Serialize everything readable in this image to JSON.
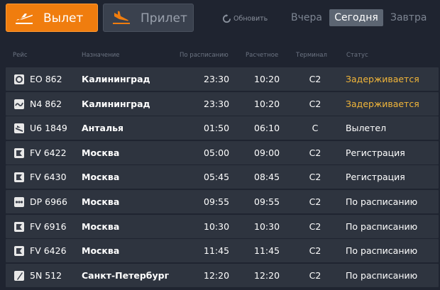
{
  "tabs": {
    "departures_label": "Вылет",
    "arrivals_label": "Прилет",
    "refresh_label": "Обновить"
  },
  "days": {
    "yesterday": "Вчера",
    "today": "Сегодня",
    "tomorrow": "Завтра"
  },
  "columns": {
    "flight": "Рейс",
    "destination": "Назначение",
    "scheduled": "По расписанию",
    "estimated": "Расчетное",
    "terminal": "Терминал",
    "status": "Статус"
  },
  "colors": {
    "accent": "#f07d0e",
    "delayed": "#f2b63a",
    "row_bg": "#2e343f",
    "page_bg": "#1f2430"
  },
  "flights": [
    {
      "logo": "circle-logo-icon",
      "flight": "EO 862",
      "destination": "Калининград",
      "scheduled": "23:30",
      "estimated": "10:20",
      "terminal": "C2",
      "status": "Задерживается",
      "delayed": true
    },
    {
      "logo": "wave-logo-icon",
      "flight": "N4 862",
      "destination": "Калининград",
      "scheduled": "23:30",
      "estimated": "10:20",
      "terminal": "C2",
      "status": "Задерживается",
      "delayed": true
    },
    {
      "logo": "wing-logo-icon",
      "flight": "U6 1849",
      "destination": "Анталья",
      "scheduled": "01:50",
      "estimated": "06:10",
      "terminal": "C",
      "status": "Вылетел",
      "delayed": false
    },
    {
      "logo": "flag-logo-icon",
      "flight": "FV 6422",
      "destination": "Москва",
      "scheduled": "05:00",
      "estimated": "09:00",
      "terminal": "C2",
      "status": "Регистрация",
      "delayed": false
    },
    {
      "logo": "flag-logo-icon",
      "flight": "FV 6430",
      "destination": "Москва",
      "scheduled": "05:45",
      "estimated": "08:45",
      "terminal": "C2",
      "status": "Регистрация",
      "delayed": false
    },
    {
      "logo": "dots-logo-icon",
      "flight": "DP 6966",
      "destination": "Москва",
      "scheduled": "09:55",
      "estimated": "09:55",
      "terminal": "C2",
      "status": "По расписанию",
      "delayed": false
    },
    {
      "logo": "flag-logo-icon",
      "flight": "FV 6916",
      "destination": "Москва",
      "scheduled": "10:30",
      "estimated": "10:30",
      "terminal": "C2",
      "status": "По расписанию",
      "delayed": false
    },
    {
      "logo": "flag-logo-icon",
      "flight": "FV 6426",
      "destination": "Москва",
      "scheduled": "11:45",
      "estimated": "11:45",
      "terminal": "C2",
      "status": "По расписанию",
      "delayed": false
    },
    {
      "logo": "slash-logo-icon",
      "flight": "5N 512",
      "destination": "Санкт-Петербург",
      "scheduled": "12:20",
      "estimated": "12:20",
      "terminal": "C2",
      "status": "По расписанию",
      "delayed": false
    }
  ]
}
